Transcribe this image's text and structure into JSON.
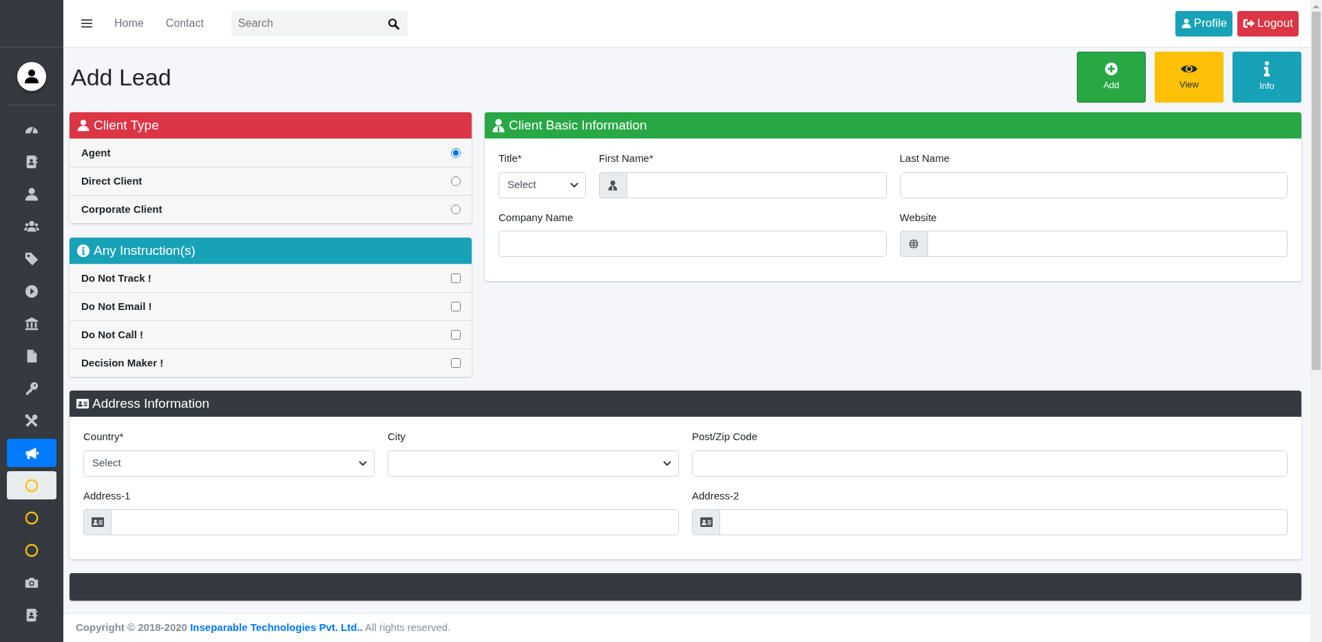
{
  "sidebar": {
    "items": [
      {
        "selected": false,
        "highlighted": false
      },
      {
        "selected": false,
        "highlighted": false
      },
      {
        "selected": false,
        "highlighted": false
      },
      {
        "selected": false,
        "highlighted": false
      },
      {
        "selected": false,
        "highlighted": false
      },
      {
        "selected": false,
        "highlighted": false
      },
      {
        "selected": false,
        "highlighted": false
      },
      {
        "selected": false,
        "highlighted": false
      },
      {
        "selected": false,
        "highlighted": false
      },
      {
        "selected": false,
        "highlighted": false
      },
      {
        "selected": true,
        "highlighted": false
      },
      {
        "selected": false,
        "highlighted": true
      },
      {
        "selected": false,
        "highlighted": false
      },
      {
        "selected": false,
        "highlighted": false
      },
      {
        "selected": false,
        "highlighted": false
      },
      {
        "selected": false,
        "highlighted": false
      }
    ]
  },
  "topbar": {
    "nav_links": [
      "Home",
      "Contact"
    ],
    "search": {
      "placeholder": "Search"
    },
    "buttons": [
      {
        "label": "Profile",
        "kind": "profile"
      },
      {
        "label": "Logout",
        "kind": "logout"
      }
    ]
  },
  "page_title": "Add Lead",
  "actions": [
    {
      "label": "Add",
      "kind": "add"
    },
    {
      "label": "View",
      "kind": "view"
    },
    {
      "label": "Info",
      "kind": "info"
    }
  ],
  "client_type": {
    "title": "Client Type",
    "options": [
      {
        "label": "Agent",
        "selected": true
      },
      {
        "label": "Direct Client",
        "selected": false
      },
      {
        "label": "Corporate Client",
        "selected": false
      }
    ]
  },
  "instructions": {
    "title": "Any Instruction(s)",
    "options": [
      {
        "label": "Do Not Track !",
        "checked": false
      },
      {
        "label": "Do Not Email !",
        "checked": false
      },
      {
        "label": "Do Not Call !",
        "checked": false
      },
      {
        "label": "Decision Maker !",
        "checked": false
      }
    ]
  },
  "basic_info": {
    "title": "Client Basic Information",
    "fields": [
      {
        "label": "Title*",
        "kind": "select",
        "value": "Select"
      },
      {
        "label": "First Name*",
        "kind": "addon"
      },
      {
        "label": "Last Name",
        "kind": "text"
      },
      {
        "label": "Company Name",
        "kind": "text"
      },
      {
        "label": "Website",
        "kind": "addon"
      }
    ]
  },
  "address_info": {
    "title": "Address Information",
    "fields": [
      {
        "label": "Country*",
        "kind": "select",
        "value": "Select"
      },
      {
        "label": "City",
        "kind": "select"
      },
      {
        "label": "Post/Zip Code",
        "kind": "text"
      },
      {
        "label": "Address-1",
        "kind": "addon"
      },
      {
        "label": "Address-2",
        "kind": "addon"
      }
    ]
  },
  "footer": {
    "copyright": "Copyright © 2018-2020",
    "link": "Inseparable Technologies Pvt. Ltd..",
    "rest": "All rights reserved."
  }
}
